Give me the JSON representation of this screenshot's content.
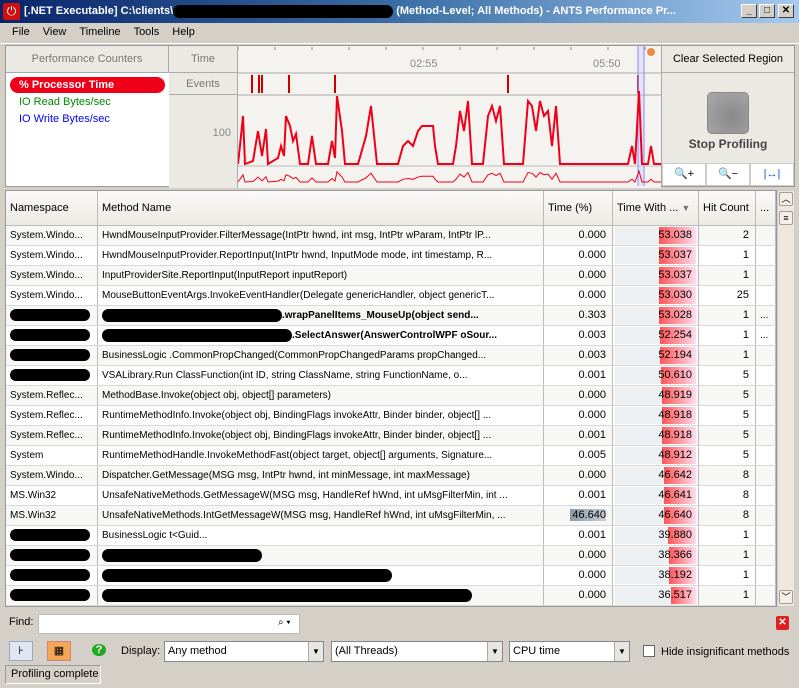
{
  "window": {
    "title_prefix": "[.NET Executable] C:\\clients\\",
    "title_suffix": "(Method-Level; All Methods) - ANTS Performance Pr...",
    "minimize": "_",
    "maximize": "□",
    "close": "✕"
  },
  "menu": [
    "File",
    "View",
    "Timeline",
    "Tools",
    "Help"
  ],
  "perf": {
    "header": "Performance Counters",
    "counters": [
      {
        "label": "% Processor Time",
        "color": "#f00018"
      },
      {
        "label": "IO Read Bytes/sec",
        "color": "#008800"
      },
      {
        "label": "IO Write Bytes/sec",
        "color": "#0000ff"
      }
    ],
    "time_label": "Time",
    "events_label": "Events",
    "y_tick": "100",
    "time_ticks": [
      "02:55",
      "05:50"
    ],
    "clear_region": "Clear Selected Region",
    "stop_profiling": "Stop Profiling",
    "zoom_in_icon": "zoom-in-icon",
    "zoom_out_icon": "zoom-out-icon",
    "fit_icon": "zoom-fit-icon"
  },
  "table": {
    "headers": [
      "Namespace",
      "Method Name",
      "Time (%)",
      "Time With ...",
      "Hit Count",
      "..."
    ],
    "rows": [
      {
        "ns": "System.Windo...",
        "method": "HwndMouseInputProvider.FilterMessage(IntPtr hwnd, int msg, IntPtr wParam, IntPtr lP...",
        "time": "0.000",
        "twc": 53.038,
        "hits": "2",
        "more": ""
      },
      {
        "ns": "System.Windo...",
        "method": "HwndMouseInputProvider.ReportInput(IntPtr hwnd, InputMode mode, int timestamp, R...",
        "time": "0.000",
        "twc": 53.037,
        "hits": "1",
        "more": ""
      },
      {
        "ns": "System.Windo...",
        "method": "InputProviderSite.ReportInput(InputReport inputReport)",
        "time": "0.000",
        "twc": 53.037,
        "hits": "1",
        "more": ""
      },
      {
        "ns": "System.Windo...",
        "method": "MouseButtonEventArgs.InvokeEventHandler(Delegate genericHandler, object genericT...",
        "time": "0.000",
        "twc": 53.03,
        "hits": "25",
        "more": ""
      },
      {
        "ns": "",
        "method": ".wrapPanelItems_MouseUp(object send...",
        "time": "0.303",
        "twc": 53.028,
        "hits": "1",
        "more": "...",
        "bold": true,
        "redact_ns": true,
        "redact_method": 180
      },
      {
        "ns": "",
        "method": ".SelectAnswer(AnswerControlWPF oSour...",
        "time": "0.003",
        "twc": 52.254,
        "hits": "1",
        "more": "...",
        "bold": true,
        "redact_ns": true,
        "redact_method": 190
      },
      {
        "ns": "",
        "method": "BusinessLogic .CommonPropChanged(CommonPropChangedParams propChanged...",
        "time": "0.003",
        "twc": 52.194,
        "hits": "1",
        "more": "",
        "redact_ns": true
      },
      {
        "ns": "",
        "method": "VSALibrary.Run ClassFunction(int ID, string ClassName, string FunctionName, o...",
        "time": "0.001",
        "twc": 50.61,
        "hits": "5",
        "more": "",
        "redact_ns": true
      },
      {
        "ns": "System.Reflec...",
        "method": "MethodBase.Invoke(object obj, object[] parameters)",
        "time": "0.000",
        "twc": 48.919,
        "hits": "5",
        "more": ""
      },
      {
        "ns": "System.Reflec...",
        "method": "RuntimeMethodInfo.Invoke(object obj, BindingFlags invokeAttr, Binder binder, object[] ...",
        "time": "0.000",
        "twc": 48.918,
        "hits": "5",
        "more": ""
      },
      {
        "ns": "System.Reflec...",
        "method": "RuntimeMethodInfo.Invoke(object obj, BindingFlags invokeAttr, Binder binder, object[] ...",
        "time": "0.001",
        "twc": 48.918,
        "hits": "5",
        "more": ""
      },
      {
        "ns": "System",
        "method": "RuntimeMethodHandle.InvokeMethodFast(object target, object[] arguments, Signature...",
        "time": "0.005",
        "twc": 48.912,
        "hits": "5",
        "more": ""
      },
      {
        "ns": "System.Windo...",
        "method": "Dispatcher.GetMessage(MSG msg, IntPtr hwnd, int minMessage, int maxMessage)",
        "time": "0.000",
        "twc": 46.642,
        "hits": "8",
        "more": ""
      },
      {
        "ns": "MS.Win32",
        "method": "UnsafeNativeMethods.GetMessageW(MSG msg, HandleRef hWnd, int uMsgFilterMin, int ...",
        "time": "0.001",
        "twc": 46.641,
        "hits": "8",
        "more": ""
      },
      {
        "ns": "MS.Win32",
        "method": "UnsafeNativeMethods.IntGetMessageW(MSG msg, HandleRef hWnd, int uMsgFilterMin, ...",
        "time": "46.640",
        "twc": 46.64,
        "hits": "8",
        "more": "",
        "time_highlight": true
      },
      {
        "ns": "",
        "method": "BusinessLogic t<Guid...",
        "time": "0.001",
        "twc": 39.88,
        "hits": "1",
        "more": "",
        "redact_ns": true
      },
      {
        "ns": "",
        "method": "",
        "time": "0.000",
        "twc": 38.366,
        "hits": "1",
        "more": "",
        "redact_ns": true,
        "redact_method": 160
      },
      {
        "ns": "",
        "method": "",
        "time": "0.000",
        "twc": 38.192,
        "hits": "1",
        "more": "",
        "redact_ns": true,
        "redact_method": 290
      },
      {
        "ns": "",
        "method": "",
        "time": "0.000",
        "twc": 36.517,
        "hits": "1",
        "more": "",
        "redact_ns": true,
        "redact_method": 370
      }
    ]
  },
  "find": {
    "label": "Find:",
    "value": "",
    "placeholder": ""
  },
  "toolbar": {
    "display_label": "Display:",
    "display_value": "Any method",
    "threads_value": "(All Threads)",
    "metric_value": "CPU time",
    "hide_label": "Hide insignificant methods",
    "hide_checked": false
  },
  "status": "Profiling complete"
}
